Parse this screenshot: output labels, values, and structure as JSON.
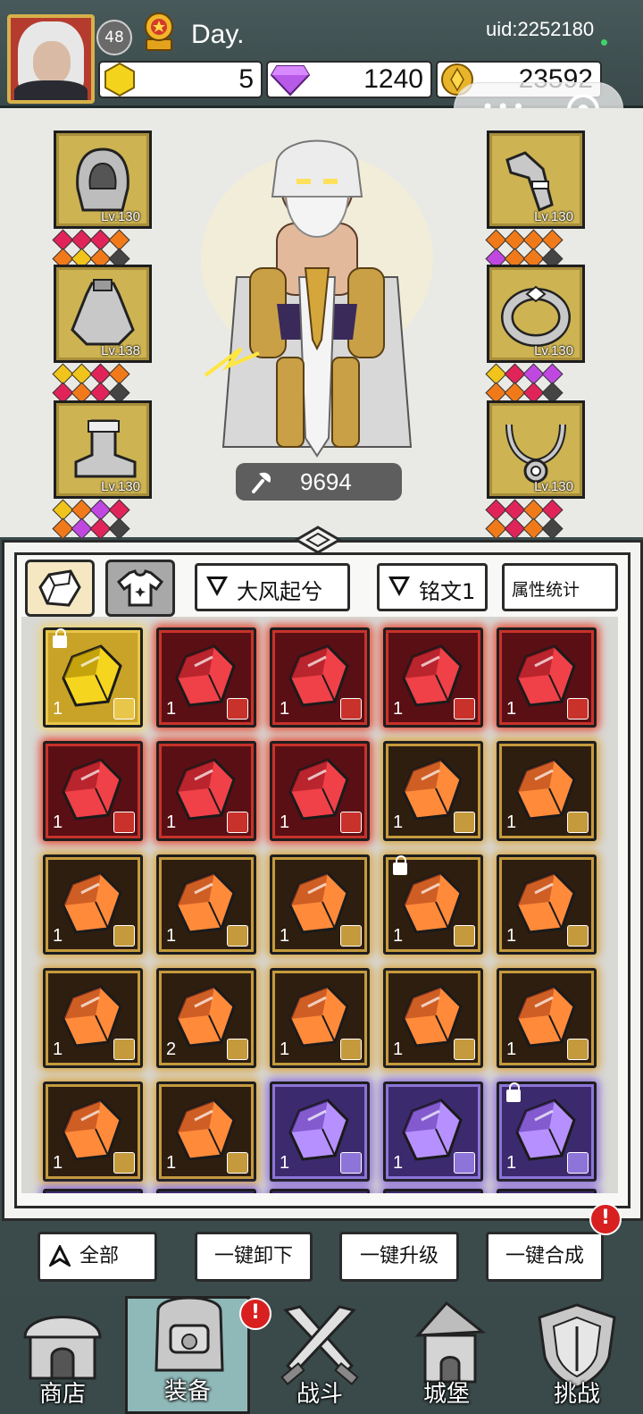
{
  "player": {
    "level": "48",
    "name": "Day.",
    "uid": "uid:2252180"
  },
  "currency": {
    "coins": "5",
    "gems": "1240",
    "gold": "23592"
  },
  "equipment": {
    "left": [
      {
        "icon": "hood-icon",
        "level": "Lv.130"
      },
      {
        "icon": "cape-icon",
        "level": "Lv.138"
      },
      {
        "icon": "boot-icon",
        "level": "Lv.130"
      }
    ],
    "right": [
      {
        "icon": "bracer-icon",
        "level": "Lv.130"
      },
      {
        "icon": "ring-icon",
        "level": "Lv.130"
      },
      {
        "icon": "necklace-icon",
        "level": "Lv.130"
      }
    ]
  },
  "hero": {
    "power": "9694"
  },
  "bag": {
    "filter_set": "大风起兮",
    "filter_rune": "铭文1",
    "stats_button": "属性统计",
    "items": [
      {
        "rarity": "gold",
        "count": "1",
        "locked": true,
        "tag": "weapon"
      },
      {
        "rarity": "red",
        "count": "1",
        "locked": false,
        "tag": "ring"
      },
      {
        "rarity": "red",
        "count": "1",
        "locked": false,
        "tag": "cape"
      },
      {
        "rarity": "red",
        "count": "1",
        "locked": false,
        "tag": "cape"
      },
      {
        "rarity": "red",
        "count": "1",
        "locked": false,
        "tag": "boot"
      },
      {
        "rarity": "red",
        "count": "1",
        "locked": false,
        "tag": "weapon"
      },
      {
        "rarity": "red",
        "count": "1",
        "locked": false,
        "tag": "weapon"
      },
      {
        "rarity": "red",
        "count": "1",
        "locked": false,
        "tag": "hood"
      },
      {
        "rarity": "orange",
        "count": "1",
        "locked": false,
        "tag": "ring"
      },
      {
        "rarity": "orange",
        "count": "1",
        "locked": false,
        "tag": "ring"
      },
      {
        "rarity": "orange",
        "count": "1",
        "locked": false,
        "tag": "boot"
      },
      {
        "rarity": "orange",
        "count": "1",
        "locked": false,
        "tag": "boot"
      },
      {
        "rarity": "orange",
        "count": "1",
        "locked": false,
        "tag": "weapon"
      },
      {
        "rarity": "orange",
        "count": "1",
        "locked": true,
        "tag": "weapon"
      },
      {
        "rarity": "orange",
        "count": "1",
        "locked": false,
        "tag": "weapon"
      },
      {
        "rarity": "orange",
        "count": "1",
        "locked": false,
        "tag": "hood"
      },
      {
        "rarity": "orange",
        "count": "2",
        "locked": false,
        "tag": "hood"
      },
      {
        "rarity": "orange",
        "count": "1",
        "locked": false,
        "tag": "hood"
      },
      {
        "rarity": "orange",
        "count": "1",
        "locked": false,
        "tag": "hood"
      },
      {
        "rarity": "orange",
        "count": "1",
        "locked": false,
        "tag": "necklace"
      },
      {
        "rarity": "orange",
        "count": "1",
        "locked": false,
        "tag": "necklace"
      },
      {
        "rarity": "orange",
        "count": "1",
        "locked": false,
        "tag": "necklace"
      },
      {
        "rarity": "purple",
        "count": "1",
        "locked": false,
        "tag": "ring"
      },
      {
        "rarity": "purple",
        "count": "1",
        "locked": false,
        "tag": "ring"
      },
      {
        "rarity": "purple",
        "count": "1",
        "locked": true,
        "tag": "ring"
      }
    ]
  },
  "actions": {
    "all": "全部",
    "unequip_all": "一键卸下",
    "upgrade_all": "一键升级",
    "merge_all": "一键合成",
    "merge_badge": "!"
  },
  "nav": {
    "shop": "商店",
    "equipment": "装备",
    "battle": "战斗",
    "castle": "城堡",
    "challenge": "挑战",
    "equipment_badge": "!"
  },
  "colors": {
    "gold": "#c9a327",
    "red": "#a0141d",
    "orange": "#d85a24",
    "purple": "#6a44b8",
    "frame_gold": "#d6b24a"
  }
}
